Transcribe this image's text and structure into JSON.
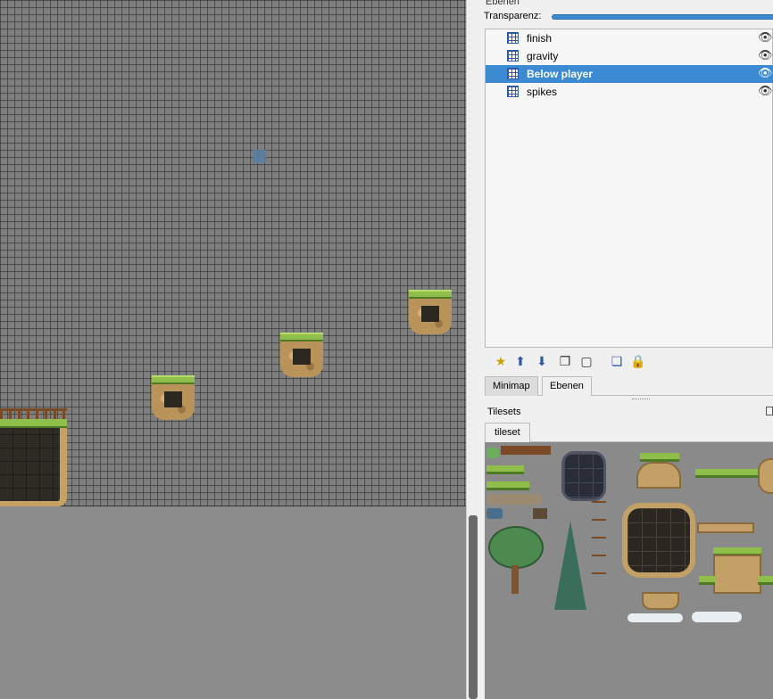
{
  "layers_panel": {
    "title": "Ebenen",
    "opacity_label": "Transparenz:",
    "opacity_value": 1.0,
    "layers": [
      {
        "name": "finish",
        "visible": true,
        "selected": false
      },
      {
        "name": "gravity",
        "visible": true,
        "selected": false
      },
      {
        "name": "Below player",
        "visible": true,
        "selected": true
      },
      {
        "name": "spikes",
        "visible": true,
        "selected": false
      }
    ],
    "toolbar_icons": [
      "new-layer-icon",
      "raise-layer-icon",
      "lower-layer-icon",
      "duplicate-layer-icon",
      "delete-layer-icon",
      "toggle-other-layers-icon",
      "lock-icon"
    ]
  },
  "dock_tabs": {
    "minimap": "Minimap",
    "layers": "Ebenen",
    "active": "Ebenen"
  },
  "tilesets_panel": {
    "title": "Tilesets",
    "tabs": [
      "tileset"
    ],
    "active_tab": "tileset"
  },
  "colors": {
    "selection": "#3b8ad2",
    "map_background": "#7e7e7e",
    "outside_map": "#8c8c8c",
    "panel_background": "#f0f0f0",
    "icon_blue": "#2d5aa8"
  }
}
